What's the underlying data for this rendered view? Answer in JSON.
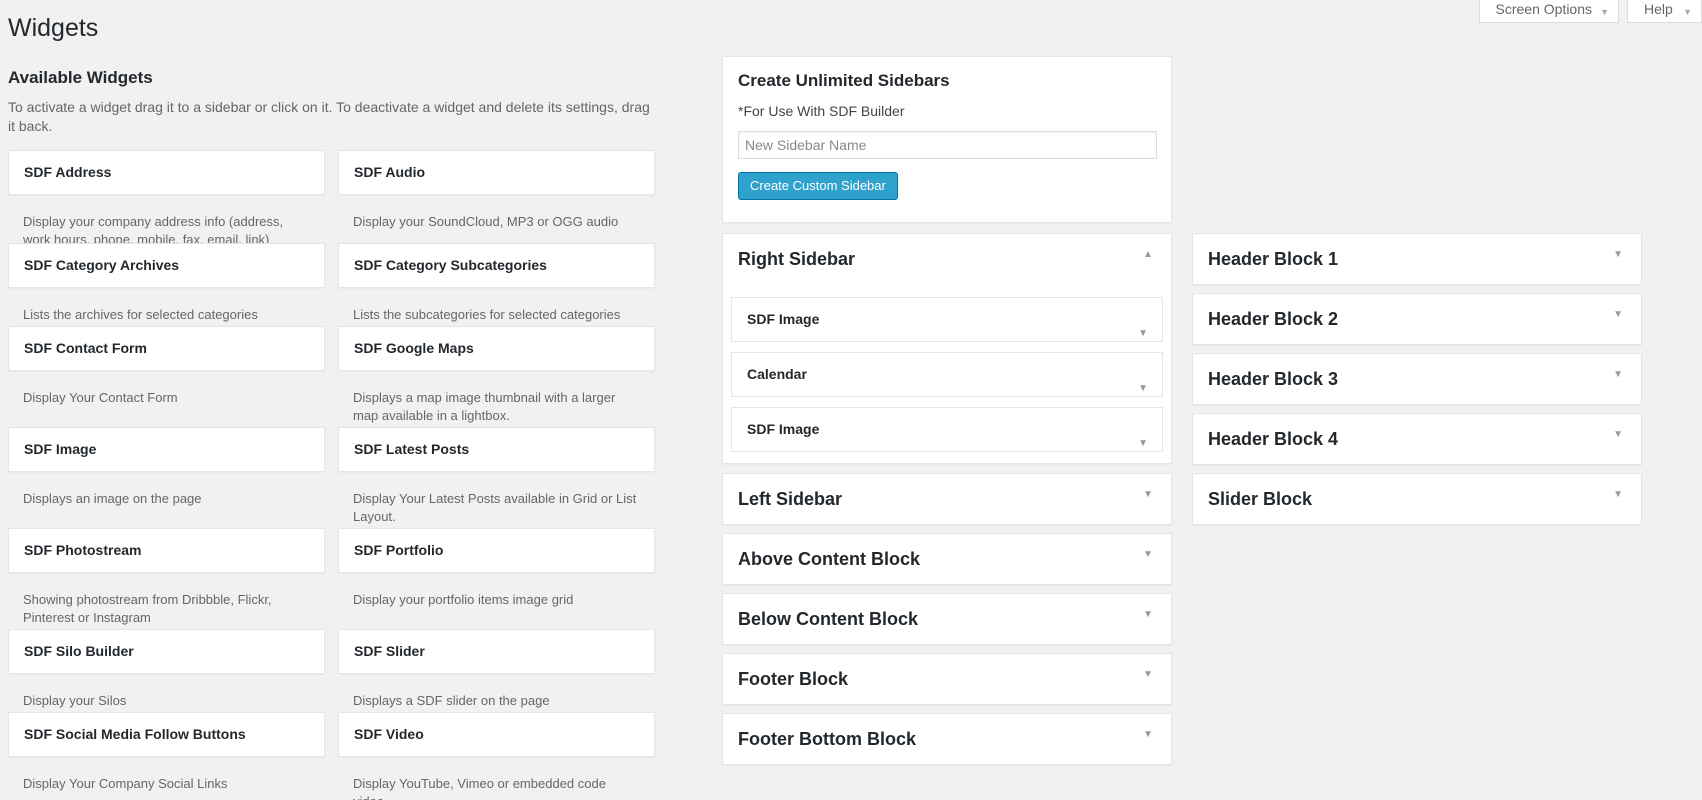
{
  "top_tabs": {
    "screen_options": "Screen Options",
    "help": "Help"
  },
  "page_title": "Widgets",
  "available": {
    "heading": "Available Widgets",
    "description": "To activate a widget drag it to a sidebar or click on it. To deactivate a widget and delete its settings, drag it back.",
    "widgets": [
      {
        "name": "SDF Address",
        "desc": "Display your company address info (address, work hours, phone, mobile, fax, email, link)"
      },
      {
        "name": "SDF Audio",
        "desc": "Display your SoundCloud, MP3 or OGG audio"
      },
      {
        "name": "SDF Category Archives",
        "desc": "Lists the archives for selected categories"
      },
      {
        "name": "SDF Category Subcategories",
        "desc": "Lists the subcategories for selected categories"
      },
      {
        "name": "SDF Contact Form",
        "desc": "Display Your Contact Form"
      },
      {
        "name": "SDF Google Maps",
        "desc": "Displays a map image thumbnail with a larger map available in a lightbox."
      },
      {
        "name": "SDF Image",
        "desc": "Displays an image on the page"
      },
      {
        "name": "SDF Latest Posts",
        "desc": "Display Your Latest Posts available in Grid or List Layout."
      },
      {
        "name": "SDF Photostream",
        "desc": "Showing photostream from Dribbble, Flickr, Pinterest or Instagram"
      },
      {
        "name": "SDF Portfolio",
        "desc": "Display your portfolio items image grid"
      },
      {
        "name": "SDF Silo Builder",
        "desc": "Display your Silos"
      },
      {
        "name": "SDF Slider",
        "desc": "Displays a SDF slider on the page"
      },
      {
        "name": "SDF Social Media Follow Buttons",
        "desc": "Display Your Company Social Links"
      },
      {
        "name": "SDF Video",
        "desc": "Display YouTube, Vimeo or embedded code video"
      }
    ]
  },
  "create": {
    "title": "Create Unlimited Sidebars",
    "subtitle": "*For Use With SDF Builder",
    "input_placeholder": "New Sidebar Name",
    "button": "Create Custom Sidebar"
  },
  "right_sidebar": {
    "title": "Right Sidebar",
    "widgets": [
      "SDF Image",
      "Calendar",
      "SDF Image"
    ]
  },
  "sidebars_col1": [
    "Left Sidebar",
    "Above Content Block",
    "Below Content Block",
    "Footer Block",
    "Footer Bottom Block"
  ],
  "sidebars_col2": [
    "Header Block 1",
    "Header Block 2",
    "Header Block 3",
    "Header Block 4",
    "Slider Block"
  ],
  "colors": {
    "accent_button": "#2ea2cc",
    "background": "#f1f1f1"
  }
}
